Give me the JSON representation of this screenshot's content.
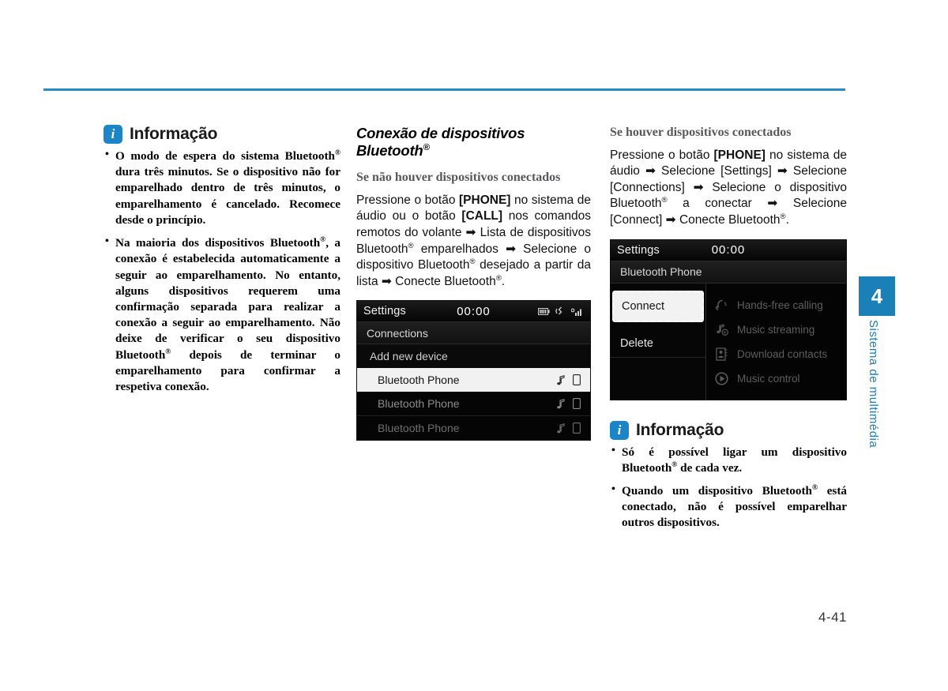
{
  "page": {
    "number": "4-41",
    "accent_color": "#1b7fb8",
    "rule_color": "#2a8bc4"
  },
  "chapter_tab": {
    "number": "4",
    "label": "Sistema de multimédia"
  },
  "left_column": {
    "info": {
      "icon": "info-icon",
      "icon_glyph": "i",
      "title": "Informação",
      "bullets": [
        "O modo de espera do sistema Bluetooth® dura três minutos. Se o dispositivo não for emparelhado dentro de três minutos, o emparelhamento é cancelado. Recomece desde o princípio.",
        "Na maioria dos dispositivos Bluetooth®, a conexão é estabelecida automaticamente a seguir ao emparelhamento. No entanto, alguns dispositivos requerem uma confirmação separada para realizar a conexão a seguir ao emparelhamento. Não deixe de verificar o seu dispositivo Bluetooth® depois de terminar o emparelhamento para confirmar a respetiva conexão."
      ]
    }
  },
  "middle_column": {
    "section_heading": "Conexão de dispositivos Bluetooth®",
    "sub_heading": "Se não houver dispositivos conectados",
    "paragraph": "Pressione o botão [PHONE] no sistema de áudio ou o botão [CALL] nos comandos remotos do volante ➡ Lista de dispositivos Bluetooth® emparelhados ➡ Selecione o dispositivo Bluetooth® desejado a partir da lista ➡ Conecte Bluetooth®.",
    "screenshot": {
      "title": "Settings",
      "clock": "00:00",
      "status_icons": [
        "battery-icon",
        "bluetooth-phone-icon",
        "signal-icon"
      ],
      "breadcrumb": "Connections",
      "add_device": "Add new device",
      "rows": [
        {
          "label": "Bluetooth Phone",
          "selected": true,
          "icons": [
            "music-note-icon",
            "phone-icon"
          ]
        },
        {
          "label": "Bluetooth Phone",
          "selected": false,
          "icons": [
            "music-note-icon",
            "phone-icon"
          ]
        },
        {
          "label": "Bluetooth Phone",
          "selected": false,
          "icons": [
            "music-note-icon",
            "phone-icon"
          ]
        }
      ]
    }
  },
  "right_column": {
    "sub_heading": "Se houver dispositivos conectados",
    "paragraph": "Pressione o botão [PHONE] no sistema de áudio ➡ Selecione [Settings] ➡ Selecione [Connections] ➡ Selecione o dispositivo Bluetooth® a conectar ➡ Selecione [Connect] ➡ Conecte Bluetooth®.",
    "screenshot": {
      "title": "Settings",
      "clock": "00:00",
      "breadcrumb": "Bluetooth Phone",
      "menu": [
        {
          "label": "Connect",
          "selected": true
        },
        {
          "label": "Delete",
          "selected": false
        }
      ],
      "features": [
        {
          "label": "Hands-free calling",
          "icon": "handsfree-call-icon"
        },
        {
          "label": "Music streaming",
          "icon": "music-streaming-icon"
        },
        {
          "label": "Download contacts",
          "icon": "contacts-icon"
        },
        {
          "label": "Music control",
          "icon": "play-icon"
        }
      ]
    },
    "info": {
      "icon": "info-icon",
      "icon_glyph": "i",
      "title": "Informação",
      "bullets": [
        "Só é possível ligar um dispositivo Bluetooth® de cada vez.",
        "Quando um dispositivo Bluetooth® está conectado, não é possível emparelhar outros dispositivos."
      ]
    }
  }
}
